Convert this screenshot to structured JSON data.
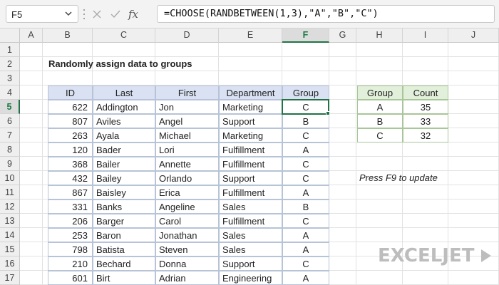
{
  "name_box": {
    "value": "F5"
  },
  "formula_bar": {
    "formula": "=CHOOSE(RANDBETWEEN(1,3),\"A\",\"B\",\"C\")",
    "fx_label": "fx"
  },
  "columns": [
    "A",
    "B",
    "C",
    "D",
    "E",
    "F",
    "G",
    "H",
    "I",
    "J"
  ],
  "rows": [
    "1",
    "2",
    "3",
    "4",
    "5",
    "6",
    "7",
    "8",
    "9",
    "10",
    "11",
    "12",
    "13",
    "14",
    "15",
    "16",
    "17"
  ],
  "active_column": "F",
  "active_row": "5",
  "sheet": {
    "title": "Randomly assign data to groups",
    "table": {
      "headers": [
        "ID",
        "Last",
        "First",
        "Department",
        "Group"
      ],
      "rows": [
        [
          "622",
          "Addington",
          "Jon",
          "Marketing",
          "C"
        ],
        [
          "807",
          "Aviles",
          "Angel",
          "Support",
          "B"
        ],
        [
          "263",
          "Ayala",
          "Michael",
          "Marketing",
          "C"
        ],
        [
          "120",
          "Bader",
          "Lori",
          "Fulfillment",
          "A"
        ],
        [
          "368",
          "Bailer",
          "Annette",
          "Fulfillment",
          "C"
        ],
        [
          "432",
          "Bailey",
          "Orlando",
          "Support",
          "C"
        ],
        [
          "867",
          "Baisley",
          "Erica",
          "Fulfillment",
          "A"
        ],
        [
          "331",
          "Banks",
          "Angeline",
          "Sales",
          "B"
        ],
        [
          "206",
          "Barger",
          "Carol",
          "Fulfillment",
          "C"
        ],
        [
          "253",
          "Baron",
          "Jonathan",
          "Sales",
          "A"
        ],
        [
          "798",
          "Batista",
          "Steven",
          "Sales",
          "A"
        ],
        [
          "210",
          "Bechard",
          "Donna",
          "Support",
          "C"
        ],
        [
          "601",
          "Birt",
          "Adrian",
          "Engineering",
          "A"
        ]
      ]
    },
    "summary": {
      "headers": [
        "Group",
        "Count"
      ],
      "rows": [
        [
          "A",
          "35"
        ],
        [
          "B",
          "33"
        ],
        [
          "C",
          "32"
        ]
      ]
    },
    "note": "Press F9 to update"
  },
  "logo": {
    "text": "EXCELJET"
  },
  "colors": {
    "accent": "#217346",
    "table_header": "#d9e1f2",
    "summary_header": "#e2efda"
  }
}
